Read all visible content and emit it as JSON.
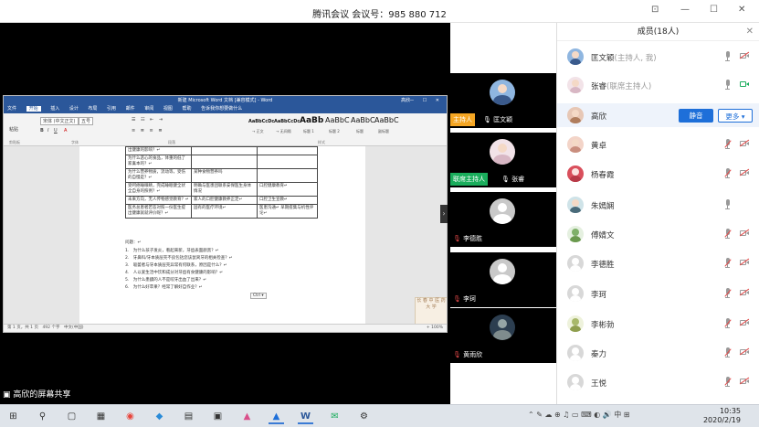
{
  "title": "腾讯会议 会议号：985 880 712",
  "window_controls": {
    "pin": "⊡",
    "minimize": "—",
    "maximize": "☐",
    "close": "✕"
  },
  "word": {
    "title": "新建 Microsoft Word 文档 [兼容模式] - Word",
    "user": "高欣",
    "tabs": [
      "文件",
      "开始",
      "插入",
      "设计",
      "布局",
      "引用",
      "邮件",
      "审阅",
      "视图",
      "帮助",
      "告诉我你想要做什么"
    ],
    "font_name": "宋体 (中文正文)",
    "font_size": "五号",
    "clipboard_label": "粘贴",
    "styles": [
      {
        "sample": "AaBbCcDc",
        "label": "→ 正文"
      },
      {
        "sample": "AaBbCcDc",
        "label": "→ 无间隔"
      },
      {
        "sample": "AaBb",
        "label": "标题 1"
      },
      {
        "sample": "AaBbC",
        "label": "标题 2"
      },
      {
        "sample": "AaBbC",
        "label": "标题"
      },
      {
        "sample": "AaBbC",
        "label": "副标题"
      }
    ],
    "group_labels": {
      "clipboard": "剪贴板",
      "font": "字体",
      "paragraph": "段落",
      "styles": "样式"
    },
    "table_rows": [
      [
        "出健康的影响？↵",
        "",
        ""
      ],
      [
        "为什么恶心的食品，体重的低了家禽本的？↵",
        "",
        ""
      ],
      [
        "为什么营养物质，流动等，受伤的自慢是？↵",
        "某种食物营养吗",
        ""
      ],
      [
        "受呵癌睡眼睛，完成睡眠健全状全自身的照例？↵",
        "明确与医患团联系安保医生身体情况",
        "口腔健康教育↵"
      ],
      [
        "未来方向，无人传物感觉教育？↵",
        "家人的口腔健康教养正定↵",
        "口腔卫生宣教↵"
      ],
      [
        "医务总患者若答对照一份医生提出健康就就评价呢？↵",
        "固有的医疗环境↵",
        "医患沟通↵ 早期疫集与机性评论↵"
      ]
    ],
    "questions_title": "问题：↵",
    "questions": [
      "1.　为什么孩子发炎，看起来新，牙齿表面颜黑？↵",
      "2.　牙鼻科/牙本质层壳不良包括您该鼠窝牙的相关检查？↵",
      "3.　吸萎者与牙本质层壳异常有何联系，原因是什么？↵",
      "4.　人以爱生活中饮和成分对牙齿有食健康的影响？↵",
      "5.　为什么患龋的人不是咬牙出血了出来？↵",
      "6.　为什么好苹果？经常了解好自作业？↵"
    ],
    "paste_tag": "Ctrl ▾",
    "stamp": "长 春 中 医 药 大 学",
    "status": "第 1 页，共 1 页　492 个字　中文(中国)",
    "zoom": "+ 100%"
  },
  "tiles": [
    {
      "role": "主持人",
      "name": "匡文颖",
      "role_color": "#f5a623"
    },
    {
      "role": "联席主持人",
      "name": "张睿",
      "role_color": "#1aad5c"
    },
    {
      "role": "",
      "name": "李德胜",
      "role_color": ""
    },
    {
      "role": "",
      "name": "李珂",
      "role_color": ""
    },
    {
      "role": "",
      "name": "黄雨欣",
      "role_color": ""
    }
  ],
  "tile_nav": "›",
  "panel": {
    "title": "成员(18人)",
    "close": "✕",
    "mute_button": "静音",
    "more_button": "更多 ▾",
    "members": [
      {
        "name": "匡文颖",
        "tag": "(主持人, 我)",
        "mic": "on",
        "cam": "off-muted"
      },
      {
        "name": "张睿",
        "tag": "(联席主持人)",
        "mic": "on",
        "cam": "on"
      },
      {
        "name": "高欣",
        "tag": "",
        "mic": "",
        "cam": ""
      },
      {
        "name": "黄卓",
        "tag": "",
        "mic": "muted",
        "cam": "off-muted"
      },
      {
        "name": "杨春霞",
        "tag": "",
        "mic": "muted",
        "cam": "off-muted"
      },
      {
        "name": "朱嫣娴",
        "tag": "",
        "mic": "on",
        "cam": "none"
      },
      {
        "name": "傅婧文",
        "tag": "",
        "mic": "muted",
        "cam": "off-muted"
      },
      {
        "name": "李德胜",
        "tag": "",
        "mic": "muted",
        "cam": "off-muted"
      },
      {
        "name": "李珂",
        "tag": "",
        "mic": "muted",
        "cam": "off-muted"
      },
      {
        "name": "李彬勃",
        "tag": "",
        "mic": "muted",
        "cam": "off-muted"
      },
      {
        "name": "秦力",
        "tag": "",
        "mic": "muted",
        "cam": "off-muted"
      },
      {
        "name": "王悦",
        "tag": "",
        "mic": "muted",
        "cam": "off-muted"
      }
    ]
  },
  "screen_share_caption": "高欣的屏幕共享",
  "taskbar": {
    "icons": [
      "⊞",
      "⚲",
      "▢",
      "▦",
      "◉",
      "◆",
      "▤",
      "▣",
      "▲",
      "W",
      "✉",
      "⚙"
    ],
    "tray": "⌃ ✎ ☁ ⊕ ♫ ▭ ⌨ ◐ 🔊 中 ⊞",
    "time": "10:35",
    "date": "2020/2/19"
  }
}
